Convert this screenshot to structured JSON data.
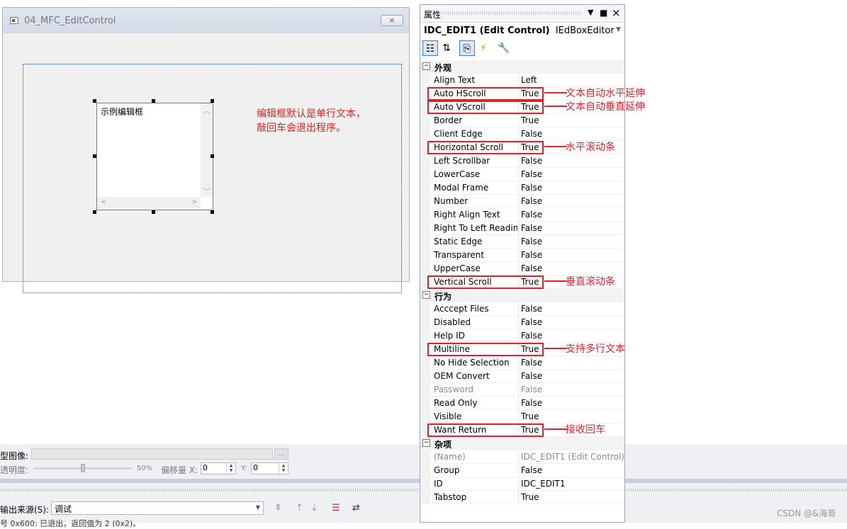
{
  "dialog": {
    "title": "04_MFC_EditControl",
    "close_label": "×",
    "edit_sample_text": "示例编辑框",
    "note_line1": "编辑框默认是单行文本，",
    "note_line2": "敲回车会退出程序。"
  },
  "properties": {
    "panel_title": "属性",
    "object_id": "IDC_EDIT1 (Edit Control)",
    "object_editor": "IEdBoxEditor",
    "categories": [
      {
        "label": "外观",
        "rows": [
          {
            "name": "Align Text",
            "value": "Left"
          },
          {
            "name": "Auto HScroll",
            "value": "True"
          },
          {
            "name": "Auto VScroll",
            "value": "True"
          },
          {
            "name": "Border",
            "value": "True"
          },
          {
            "name": "Client Edge",
            "value": "False"
          },
          {
            "name": "Horizontal Scroll",
            "value": "True"
          },
          {
            "name": "Left Scrollbar",
            "value": "False"
          },
          {
            "name": "LowerCase",
            "value": "False"
          },
          {
            "name": "Modal Frame",
            "value": "False"
          },
          {
            "name": "Number",
            "value": "False"
          },
          {
            "name": "Right Align Text",
            "value": "False"
          },
          {
            "name": "Right To Left Readin",
            "value": "False"
          },
          {
            "name": "Static Edge",
            "value": "False"
          },
          {
            "name": "Transparent",
            "value": "False"
          },
          {
            "name": "UpperCase",
            "value": "False"
          },
          {
            "name": "Vertical Scroll",
            "value": "True"
          }
        ]
      },
      {
        "label": "行为",
        "rows": [
          {
            "name": "Acccept Files",
            "value": "False"
          },
          {
            "name": "Disabled",
            "value": "False"
          },
          {
            "name": "Help ID",
            "value": "False"
          },
          {
            "name": "Multiline",
            "value": "True"
          },
          {
            "name": "No Hide Selection",
            "value": "False"
          },
          {
            "name": "OEM Convert",
            "value": "False"
          },
          {
            "name": "Password",
            "value": "False"
          },
          {
            "name": "Read Only",
            "value": "False"
          },
          {
            "name": "Visible",
            "value": "True"
          },
          {
            "name": "Want Return",
            "value": "True"
          }
        ]
      },
      {
        "label": "杂项",
        "rows": [
          {
            "name": "(Name)",
            "value": "IDC_EDIT1 (Edit Control)"
          },
          {
            "name": "Group",
            "value": "False"
          },
          {
            "name": "ID",
            "value": "IDC_EDIT1"
          },
          {
            "name": "Tabstop",
            "value": "True"
          }
        ]
      }
    ]
  },
  "annotations": {
    "auto_hscroll": "文本自动水平延伸",
    "auto_vscroll": "文本自动垂直延伸",
    "horizontal_scroll": "水平滚动条",
    "vertical_scroll": "垂直滚动条",
    "multiline": "支持多行文本",
    "want_return": "接收回车"
  },
  "bottom": {
    "image_label": "型图像:",
    "transparency_label": "透明度:",
    "transparency_value": "50%",
    "offset_label": "偏移量 X:",
    "x_value": "0",
    "y_label": "Y:",
    "y_value": "0",
    "output_source_label": "输出来源(S):",
    "output_source_value": "调试",
    "output_text": "号 0x600: 已退出，返回值为 2 (0x2)。"
  },
  "watermark": "CSDN @&海哥",
  "colors": {
    "annotation_red": "#e0212f",
    "dotted_blue": "#1a3fb8"
  }
}
